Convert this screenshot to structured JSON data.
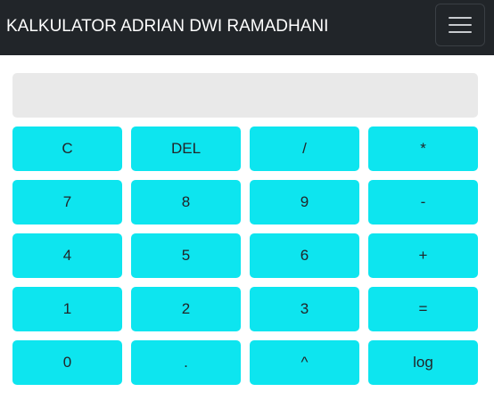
{
  "navbar": {
    "title": "KALKULATOR ADRIAN DWI RAMADHANI",
    "background": "#212529",
    "toggler_icon": "hamburger-menu-icon"
  },
  "display": {
    "value": "",
    "background": "#e9e9e9"
  },
  "key_color": "#0de5ef",
  "keys": {
    "clear": "C",
    "delete": "DEL",
    "divide": "/",
    "multiply": "*",
    "seven": "7",
    "eight": "8",
    "nine": "9",
    "minus": "-",
    "four": "4",
    "five": "5",
    "six": "6",
    "plus": "+",
    "one": "1",
    "two": "2",
    "three": "3",
    "equals": "=",
    "zero": "0",
    "decimal": ".",
    "power": "^",
    "log": "log"
  }
}
